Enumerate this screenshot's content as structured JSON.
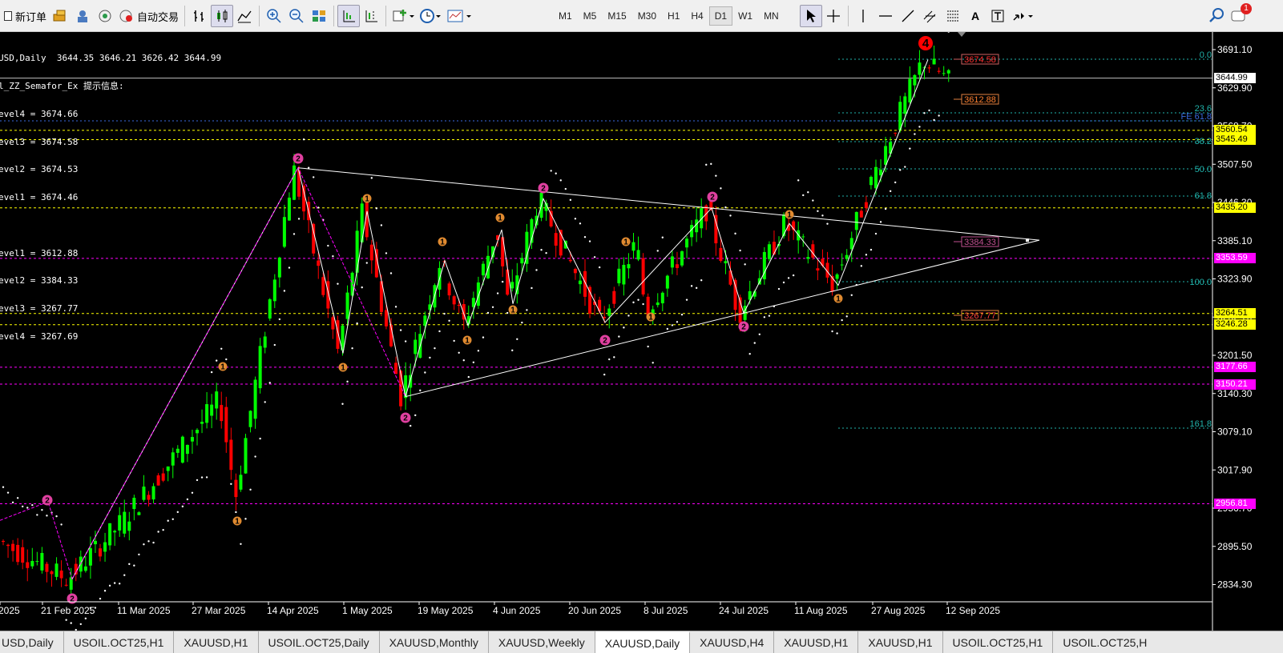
{
  "toolbar": {
    "new_order": "新订单",
    "auto_trading": "自动交易",
    "timeframes": [
      "M1",
      "M5",
      "M15",
      "M30",
      "H1",
      "H4",
      "D1",
      "W1",
      "MN"
    ],
    "active_timeframe": "D1",
    "alert_count": "1"
  },
  "chart": {
    "info_lines": [
      "USD,Daily  3644.35 3646.21 3626.42 3644.99",
      "l_ZZ_Semafor_Ex 提示信息:",
      "evel4 = 3674.66",
      "evel3 = 3674.58",
      "evel2 = 3674.53",
      "evel1 = 3674.46",
      "",
      "evel1 = 3612.88",
      "evel2 = 3384.33",
      "evel3 = 3267.77",
      "evel4 = 3267.69"
    ],
    "price_axis": [
      "3691.10",
      "3629.90",
      "3568.70",
      "3507.50",
      "3446.30",
      "3385.10",
      "3323.90",
      "3262.70",
      "3201.50",
      "3140.30",
      "3079.10",
      "3017.90",
      "2956.70",
      "2895.50",
      "2834.30"
    ],
    "date_axis": [
      "2025",
      "21 Feb 2025",
      "11 Mar 2025",
      "27 Mar 2025",
      "14 Apr 2025",
      "1 May 2025",
      "19 May 2025",
      "4 Jun 2025",
      "20 Jun 2025",
      "8 Jul 2025",
      "24 Jul 2025",
      "11 Aug 2025",
      "27 Aug 2025",
      "12 Sep 2025"
    ],
    "current_price": "3644.99",
    "level_labels": [
      {
        "text": "3560.54",
        "bg": "#ffff00",
        "fg": "#000000"
      },
      {
        "text": "3545.49",
        "bg": "#ffff00",
        "fg": "#000000"
      },
      {
        "text": "3435.20",
        "bg": "#ffff00",
        "fg": "#000000"
      },
      {
        "text": "3353.59",
        "bg": "#ff00ff",
        "fg": "#ffffff"
      },
      {
        "text": "3264.51",
        "bg": "#ffff00",
        "fg": "#000000"
      },
      {
        "text": "3246.28",
        "bg": "#ffff00",
        "fg": "#000000"
      },
      {
        "text": "3177.66",
        "bg": "#ff00ff",
        "fg": "#ffffff"
      },
      {
        "text": "3150.21",
        "bg": "#ff00ff",
        "fg": "#ffffff"
      },
      {
        "text": "2956.81",
        "bg": "#ff00ff",
        "fg": "#ffffff"
      }
    ],
    "fib_labels": [
      "0.0",
      "23.6",
      "FE 61.8",
      "38.2",
      "50.0",
      "61.8",
      "100.0",
      "161.8"
    ],
    "semafor_labels": [
      "3674.58",
      "3612.88",
      "3384.33",
      "3267.77"
    ],
    "peak_marker": "4",
    "colors": {
      "bull": "#00ff00",
      "bear": "#ff0000",
      "fib": "#20b2aa",
      "yellow": "#ffff00",
      "magenta": "#ff00ff"
    }
  },
  "tabs": [
    "USD,Daily",
    "USOIL.OCT25,H1",
    "XAUUSD,H1",
    "USOIL.OCT25,Daily",
    "XAUUSD,Monthly",
    "XAUUSD,Weekly",
    "XAUUSD,Daily",
    "XAUUSD,H4",
    "XAUUSD,H1",
    "XAUUSD,H1",
    "USOIL.OCT25,H1",
    "USOIL.OCT25,H"
  ],
  "active_tab": "XAUUSD,Daily"
}
